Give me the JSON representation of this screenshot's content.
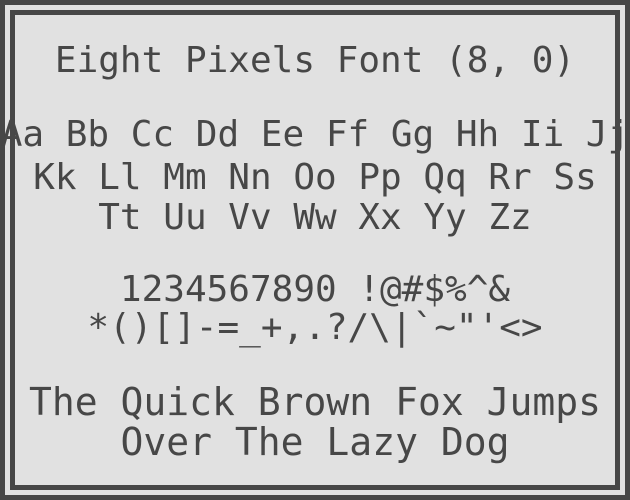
{
  "title": "Eight Pixels Font (8, 0)",
  "alphabet": [
    "Aa Bb Cc Dd Ee Ff Gg Hh Ii Jj",
    "Kk Ll Mm Nn Oo Pp Qq Rr Ss",
    "Tt Uu Vv Ww Xx Yy Zz"
  ],
  "symbols": [
    "1234567890 !@#$%^&",
    "*()[]-=_+,.?/\\|`~\"'<>"
  ],
  "pangram": [
    "The Quick Brown Fox Jumps",
    "Over The Lazy Dog"
  ],
  "colors": {
    "background": "#e1e1e1",
    "foreground": "#474747"
  }
}
